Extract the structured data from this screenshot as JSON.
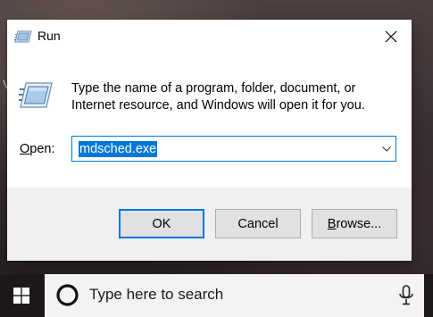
{
  "background": {
    "partial_text": "V"
  },
  "dialog": {
    "title": "Run",
    "description": "Type the name of a program, folder, document, or Internet resource, and Windows will open it for you.",
    "open_label": "Open:",
    "open_label_accel": "O",
    "open_label_rest": "pen:",
    "command_value": "mdsched.exe",
    "buttons": {
      "ok": "OK",
      "cancel": "Cancel",
      "browse": "Browse...",
      "browse_accel": "B",
      "browse_rest": "rowse..."
    },
    "icons": {
      "title": "run-app-icon",
      "big": "run-program-icon",
      "close": "close-icon",
      "dropdown": "chevron-down-icon"
    },
    "colors": {
      "accent": "#0078d7",
      "button_face": "#e1e1e1",
      "button_bar": "#f0f0f0"
    }
  },
  "taskbar": {
    "search_placeholder": "Type here to search",
    "icons": {
      "start": "windows-start-icon",
      "search": "cortana-circle-icon",
      "mic": "microphone-icon"
    },
    "colors": {
      "taskbar": "#1d1719",
      "search_box": "#f3f3f3"
    }
  }
}
